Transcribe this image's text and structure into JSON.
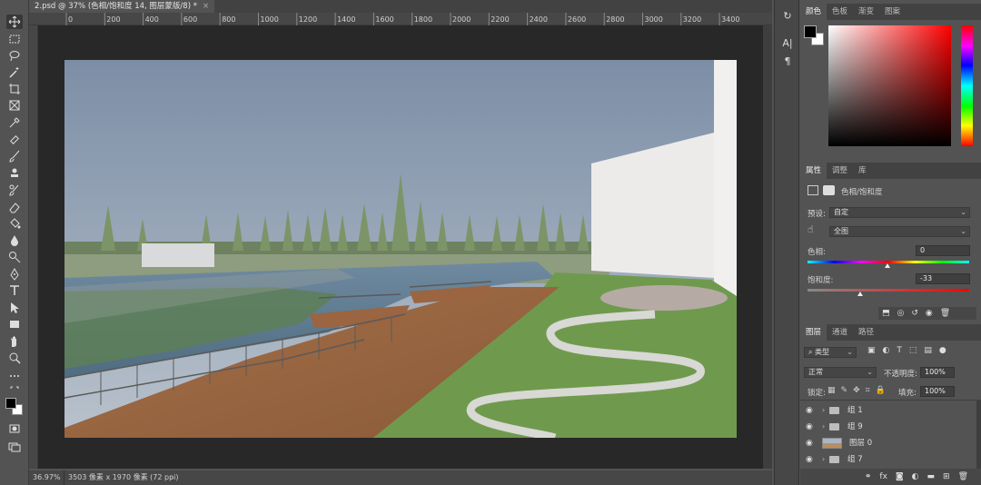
{
  "document_tab": {
    "title": "2.psd @ 37% (色相/饱和度 14, 图层蒙版/8) *",
    "close": "×"
  },
  "ruler_top_ticks": [
    "0",
    "200",
    "400",
    "600",
    "800",
    "1000",
    "1200",
    "1400",
    "1600",
    "1800",
    "2000",
    "2200",
    "2400",
    "2600",
    "2800",
    "3000",
    "3200",
    "3400"
  ],
  "status": {
    "zoom": "36.97%",
    "doc_info": "3503 像素 x 1970 像素 (72 ppi)"
  },
  "mini_panel": {
    "btn1": "A|",
    "btn2": "¶"
  },
  "color_panel": {
    "tabs": [
      "颜色",
      "色板",
      "渐变",
      "图案"
    ],
    "foreground": "#000000",
    "background": "#ffffff",
    "hue": "#ff0000"
  },
  "properties_panel": {
    "tabs": [
      "属性",
      "调整",
      "库"
    ],
    "heading": "色相/饱和度",
    "preset_label": "预设:",
    "preset_value": "自定",
    "channel_value": "全图",
    "hue_label": "色相:",
    "hue_value": "0",
    "saturation_label": "饱和度:",
    "saturation_value": "-33"
  },
  "layers_panel": {
    "tabs": [
      "图层",
      "通道",
      "路径"
    ],
    "filter_kind": "类型",
    "blend_mode": "正常",
    "opacity_label": "不透明度:",
    "opacity_value": "100%",
    "lock_label": "锁定:",
    "fill_label": "填充:",
    "fill_value": "100%",
    "layers": [
      {
        "name": "组 1",
        "type": "group"
      },
      {
        "name": "组 9",
        "type": "group"
      },
      {
        "name": "图层 0",
        "type": "image"
      },
      {
        "name": "组 7",
        "type": "group"
      }
    ]
  }
}
